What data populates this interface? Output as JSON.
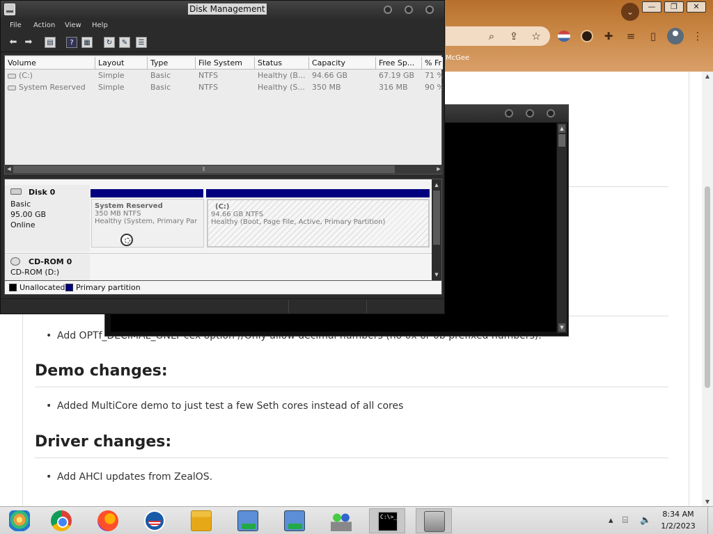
{
  "browser": {
    "window_controls": [
      "—",
      "❐",
      "✕"
    ],
    "bookmark_text": "McGee",
    "article": {
      "cutoff_bullet": "Add OPTf_DECIMAL_ONLY cex option //Only allow decimal numbers (no 0x or 0b prefixed numbers).",
      "sections": [
        {
          "heading": "Demo changes:",
          "bullets": [
            "Added MultiCore demo to just test a few Seth cores instead of all cores"
          ]
        },
        {
          "heading": "Driver changes:",
          "bullets": [
            "Add AHCI updates from ZealOS."
          ]
        }
      ]
    }
  },
  "disk_management": {
    "title": "Disk Management",
    "menu": [
      "File",
      "Action",
      "View",
      "Help"
    ],
    "columns": [
      "Volume",
      "Layout",
      "Type",
      "File System",
      "Status",
      "Capacity",
      "Free Sp...",
      "% Fr"
    ],
    "volumes": [
      [
        "(C:)",
        "Simple",
        "Basic",
        "NTFS",
        "Healthy (B...",
        "94.66 GB",
        "67.19 GB",
        "71 %"
      ],
      [
        "System Reserved",
        "Simple",
        "Basic",
        "NTFS",
        "Healthy (S...",
        "350 MB",
        "316 MB",
        "90 %"
      ]
    ],
    "disks": [
      {
        "name": "Disk 0",
        "type": "Basic",
        "size": "95.00 GB",
        "state": "Online"
      },
      {
        "name": "CD-ROM 0",
        "type": "CD-ROM (D:)"
      }
    ],
    "partitions": [
      {
        "title": "System Reserved",
        "size": "350 MB NTFS",
        "status": "Healthy (System, Primary Par"
      },
      {
        "title": "(C:)",
        "size": "94.66 GB NTFS",
        "status": "Healthy (Boot, Page File, Active, Primary Partition)"
      }
    ],
    "legend": [
      {
        "label": "Unallocated",
        "color": "#000000"
      },
      {
        "label": "Primary partition",
        "color": "#00007f"
      }
    ]
  },
  "taskbar": {
    "time": "8:34 AM",
    "date": "1/2/2023",
    "cmd_icon_text": "C:\\>_"
  },
  "colors": {
    "primary_partition": "#00007f",
    "browser_theme": "#c98745"
  }
}
